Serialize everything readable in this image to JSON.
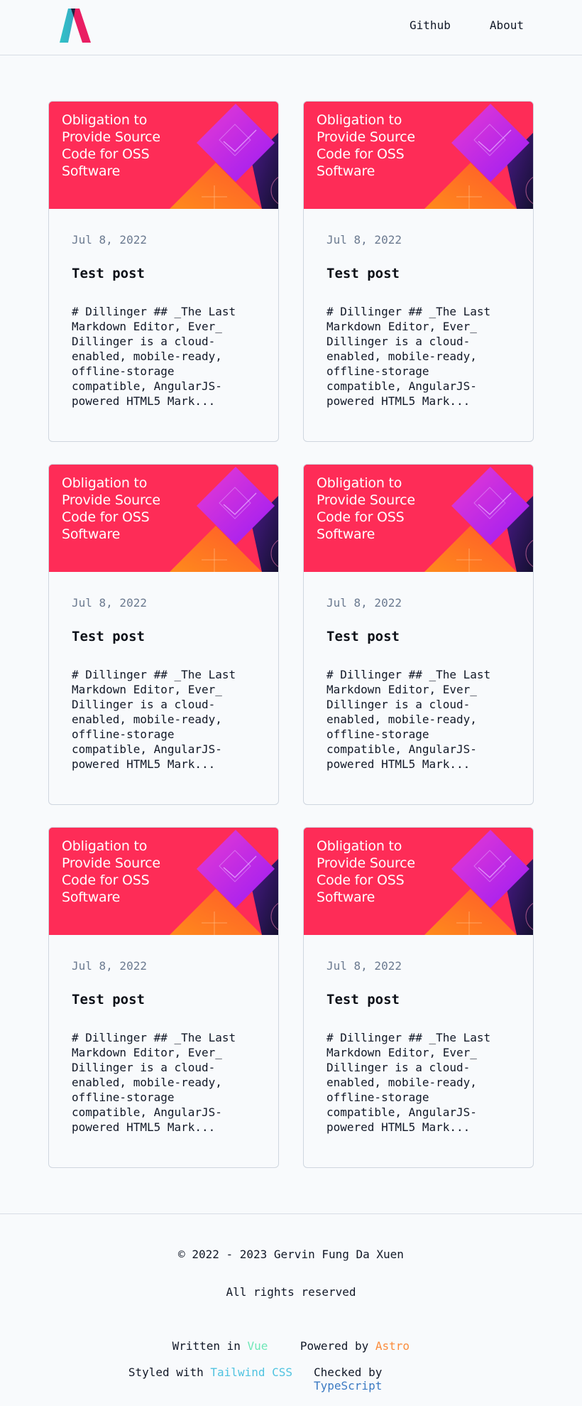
{
  "header": {
    "nav": [
      {
        "label": "Github"
      },
      {
        "label": "About"
      }
    ]
  },
  "posts": [
    {
      "banner_title": "Obligation to Provide Source Code for OSS Software",
      "date": "Jul 8, 2022",
      "title": "Test post",
      "excerpt": "# Dillinger ## _The Last Markdown Editor, Ever_ Dillinger is a cloud-enabled, mobile-ready, offline-storage compatible, AngularJS-powered HTML5 Mark..."
    },
    {
      "banner_title": "Obligation to Provide Source Code for OSS Software",
      "date": "Jul 8, 2022",
      "title": "Test post",
      "excerpt": "# Dillinger ## _The Last Markdown Editor, Ever_ Dillinger is a cloud-enabled, mobile-ready, offline-storage compatible, AngularJS-powered HTML5 Mark..."
    },
    {
      "banner_title": "Obligation to Provide Source Code for OSS Software",
      "date": "Jul 8, 2022",
      "title": "Test post",
      "excerpt": "# Dillinger ## _The Last Markdown Editor, Ever_ Dillinger is a cloud-enabled, mobile-ready, offline-storage compatible, AngularJS-powered HTML5 Mark..."
    },
    {
      "banner_title": "Obligation to Provide Source Code for OSS Software",
      "date": "Jul 8, 2022",
      "title": "Test post",
      "excerpt": "# Dillinger ## _The Last Markdown Editor, Ever_ Dillinger is a cloud-enabled, mobile-ready, offline-storage compatible, AngularJS-powered HTML5 Mark..."
    },
    {
      "banner_title": "Obligation to Provide Source Code for OSS Software",
      "date": "Jul 8, 2022",
      "title": "Test post",
      "excerpt": "# Dillinger ## _The Last Markdown Editor, Ever_ Dillinger is a cloud-enabled, mobile-ready, offline-storage compatible, AngularJS-powered HTML5 Mark..."
    },
    {
      "banner_title": "Obligation to Provide Source Code for OSS Software",
      "date": "Jul 8, 2022",
      "title": "Test post",
      "excerpt": "# Dillinger ## _The Last Markdown Editor, Ever_ Dillinger is a cloud-enabled, mobile-ready, offline-storage compatible, AngularJS-powered HTML5 Mark..."
    }
  ],
  "footer": {
    "copyright": "© 2022 - 2023 Gervin Fung Da Xuen",
    "rights": "All rights reserved",
    "written_prefix": "Written in ",
    "written_link": "Vue",
    "powered_prefix": "Powered by ",
    "powered_link": "Astro",
    "styled_prefix": "Styled with ",
    "styled_link": "Tailwind CSS",
    "checked_prefix": "Checked by ",
    "checked_link": "TypeScript"
  },
  "colors": {
    "banner_pink": "#fe2c57",
    "vue": "#6ee7b7",
    "astro": "#fb8c3c",
    "tailwind": "#4fc3e0",
    "typescript": "#3b7ac2"
  },
  "icons": {
    "logo": "logo-a-icon"
  }
}
